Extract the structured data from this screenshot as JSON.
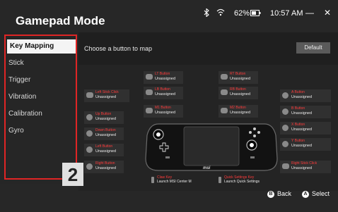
{
  "title": "Gamepad Mode",
  "status": {
    "battery": "62%",
    "time": "10:57 AM"
  },
  "window": {
    "minimize": "—",
    "close": "✕"
  },
  "sidebar": [
    {
      "label": "Key Mapping",
      "active": true
    },
    {
      "label": "Stick"
    },
    {
      "label": "Trigger"
    },
    {
      "label": "Vibration"
    },
    {
      "label": "Calibration"
    },
    {
      "label": "Gyro"
    }
  ],
  "badge": "2",
  "prompt": "Choose a button to map",
  "default_button": "Default",
  "mappings": {
    "lt": {
      "name": "LT Button",
      "value": "Unassigned"
    },
    "lb": {
      "name": "LB Button",
      "value": "Unassigned"
    },
    "m1": {
      "name": "M1 Button",
      "value": "Unassigned"
    },
    "rt": {
      "name": "RT Button",
      "value": "Unassigned"
    },
    "rb": {
      "name": "RB Button",
      "value": "Unassigned"
    },
    "m2": {
      "name": "M2 Button",
      "value": "Unassigned"
    },
    "left_stick": {
      "name": "Left Stick Click",
      "value": "Unassigned"
    },
    "up": {
      "name": "Up Button",
      "value": "Unassigned"
    },
    "down": {
      "name": "Down Button",
      "value": "Unassigned"
    },
    "left": {
      "name": "Left Button",
      "value": "Unassigned"
    },
    "right": {
      "name": "Right Button",
      "value": "Unassigned"
    },
    "a": {
      "name": "A Button",
      "value": "Unassigned"
    },
    "b": {
      "name": "B Button",
      "value": "Unassigned"
    },
    "x": {
      "name": "X Button",
      "value": "Unassigned"
    },
    "y": {
      "name": "Y Button",
      "value": "Unassigned"
    },
    "right_stick": {
      "name": "Right Stick Click",
      "value": "Unassigned"
    },
    "claw": {
      "name": "Claw Key",
      "value": "Launch MSI Center M"
    },
    "qs": {
      "name": "Quick Settings Key",
      "value": "Launch Quick Settings"
    }
  },
  "device_brand": "msi",
  "footer": {
    "back_glyph": "B",
    "back": "Back",
    "select_glyph": "A",
    "select": "Select"
  },
  "colors": {
    "accent_red": "#ff3b3b",
    "frame_red": "#e02525"
  },
  "icons": [
    "bluetooth-icon",
    "wifi-icon",
    "battery-icon"
  ]
}
